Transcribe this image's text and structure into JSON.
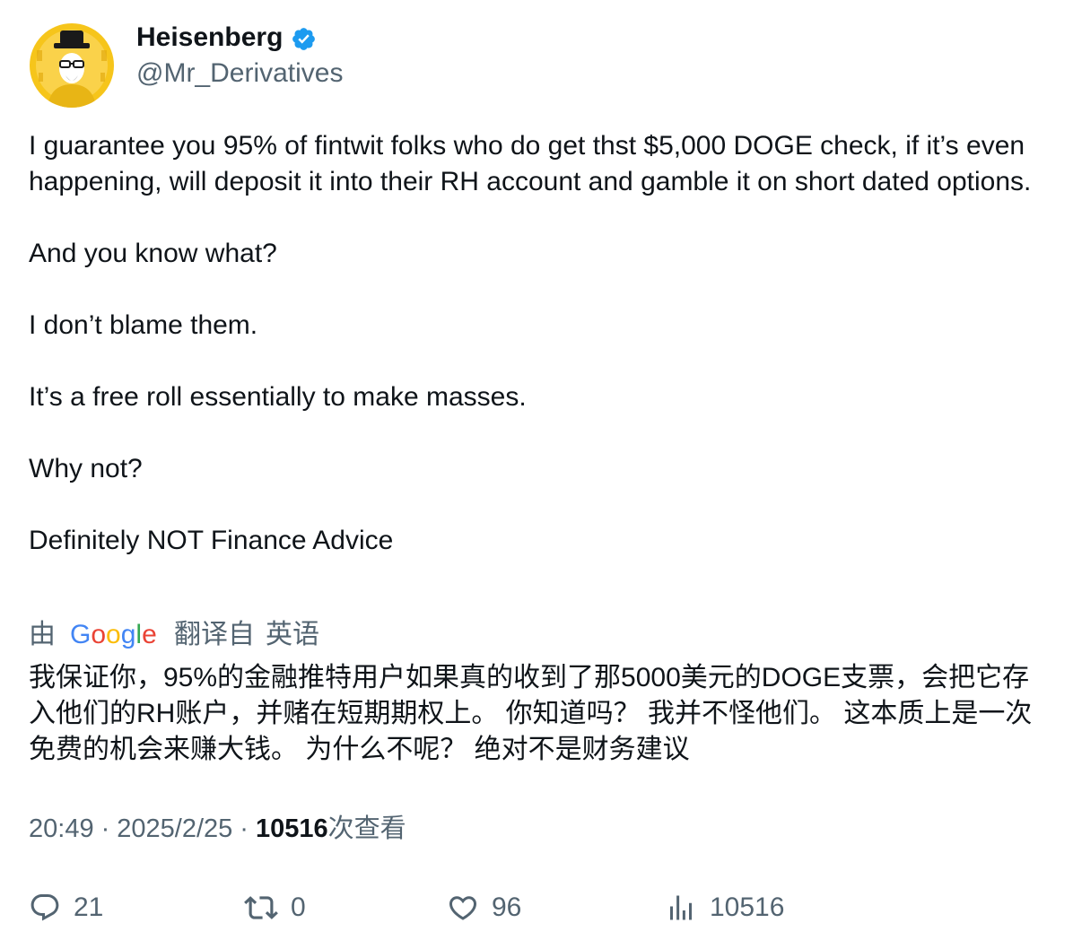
{
  "author": {
    "display_name": "Heisenberg",
    "handle": "@Mr_Derivatives",
    "verified_icon": "verified-badge-icon",
    "avatar_icon": "avatar-image"
  },
  "tweet": {
    "paragraphs": [
      "I guarantee you 95% of fintwit folks who do get thst $5,000 DOGE check, if it’s even happening, will deposit it into their RH account and gamble it on short dated options.",
      "And you know what?",
      "I don’t blame them.",
      "It’s a free roll essentially to make masses.",
      "Why not?",
      "Definitely NOT Finance Advice"
    ]
  },
  "translation": {
    "by_label": "由",
    "provider": "Google",
    "from_label": "翻译自",
    "source_language": "英语",
    "text": "我保证你，95%的金融推特用户如果真的收到了那5000美元的DOGE支票，会把它存入他们的RH账户，并赌在短期期权上。 你知道吗？ 我并不怪他们。 这本质上是一次免费的机会来赚大钱。 为什么不呢？ 绝对不是财务建议"
  },
  "meta": {
    "time": "20:49",
    "separator": "·",
    "date": "2025/2/25",
    "views_count": "10516",
    "views_label": "次查看"
  },
  "actions": {
    "reply": {
      "count": "21",
      "icon": "reply-icon"
    },
    "retweet": {
      "count": "0",
      "icon": "retweet-icon"
    },
    "like": {
      "count": "96",
      "icon": "heart-icon"
    },
    "views": {
      "count": "10516",
      "icon": "analytics-icon"
    }
  },
  "colors": {
    "text_primary": "#0f1419",
    "text_secondary": "#536471",
    "verified_blue": "#1d9bf0",
    "avatar_yellow": "#f6c51b",
    "google_blue": "#4285F4",
    "google_red": "#EA4335",
    "google_yellow": "#FBBC05",
    "google_green": "#34A853"
  }
}
